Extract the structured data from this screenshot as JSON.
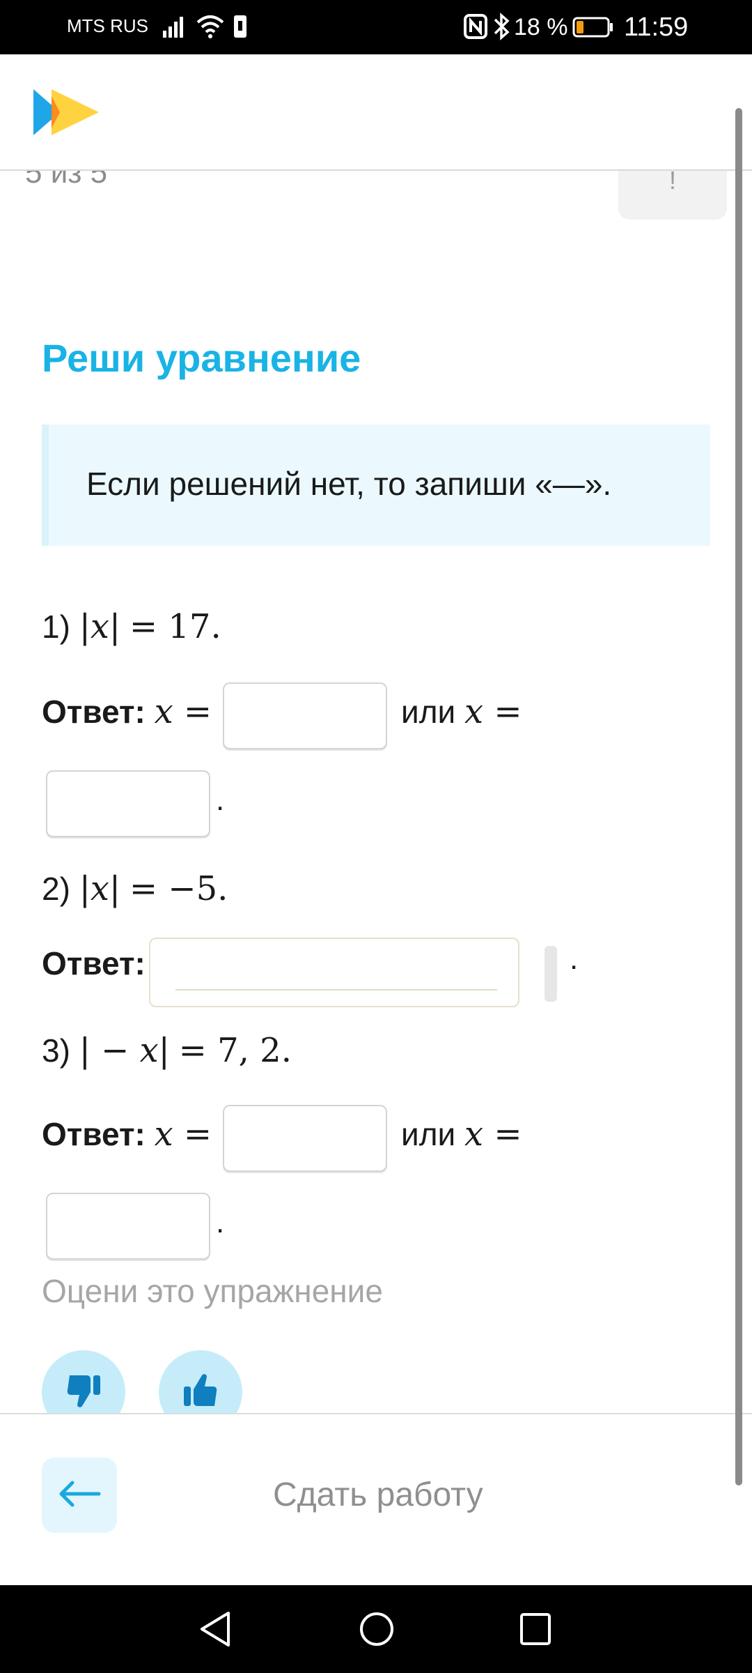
{
  "status_bar": {
    "carrier": "MTS RUS",
    "battery_percent": "18 %",
    "time": "11:59",
    "icons": [
      "signal-icon",
      "wifi-icon",
      "sim-icon",
      "nfc-icon",
      "bluetooth-icon",
      "battery-icon"
    ],
    "battery_level": 0.18,
    "battery_color": "#f39c12"
  },
  "header": {
    "logo": "app-logo-icon"
  },
  "task": {
    "counter": "5 из 5",
    "report_glyph": "!",
    "title": "Реши уравнение",
    "hint": "Если решений нет, то запиши «—».",
    "answer_label": "Ответ:",
    "or_label": "или",
    "period": ".",
    "problems": [
      {
        "number": "1)",
        "equation_lhs": "|x|",
        "equation_rhs": "= 17."
      },
      {
        "number": "2)",
        "equation_lhs": "|x|",
        "equation_rhs": "= −5."
      },
      {
        "number": "3)",
        "equation_lhs": "| − x|",
        "equation_rhs": "= 7, 2."
      }
    ],
    "answer_expr": "x ="
  },
  "rating": {
    "label": "Оцени это упражнение",
    "dislike_icon": "thumbs-down-icon",
    "like_icon": "thumbs-up-icon"
  },
  "bottom_bar": {
    "back_icon": "arrow-left-icon",
    "submit_label": "Сдать работу"
  },
  "nav_bar": {
    "icons": [
      "nav-back-icon",
      "nav-home-icon",
      "nav-recents-icon"
    ]
  },
  "colors": {
    "accent": "#19b3e6",
    "hint_bg": "#ebf9fe",
    "rating_button": "#c6ecfa"
  }
}
